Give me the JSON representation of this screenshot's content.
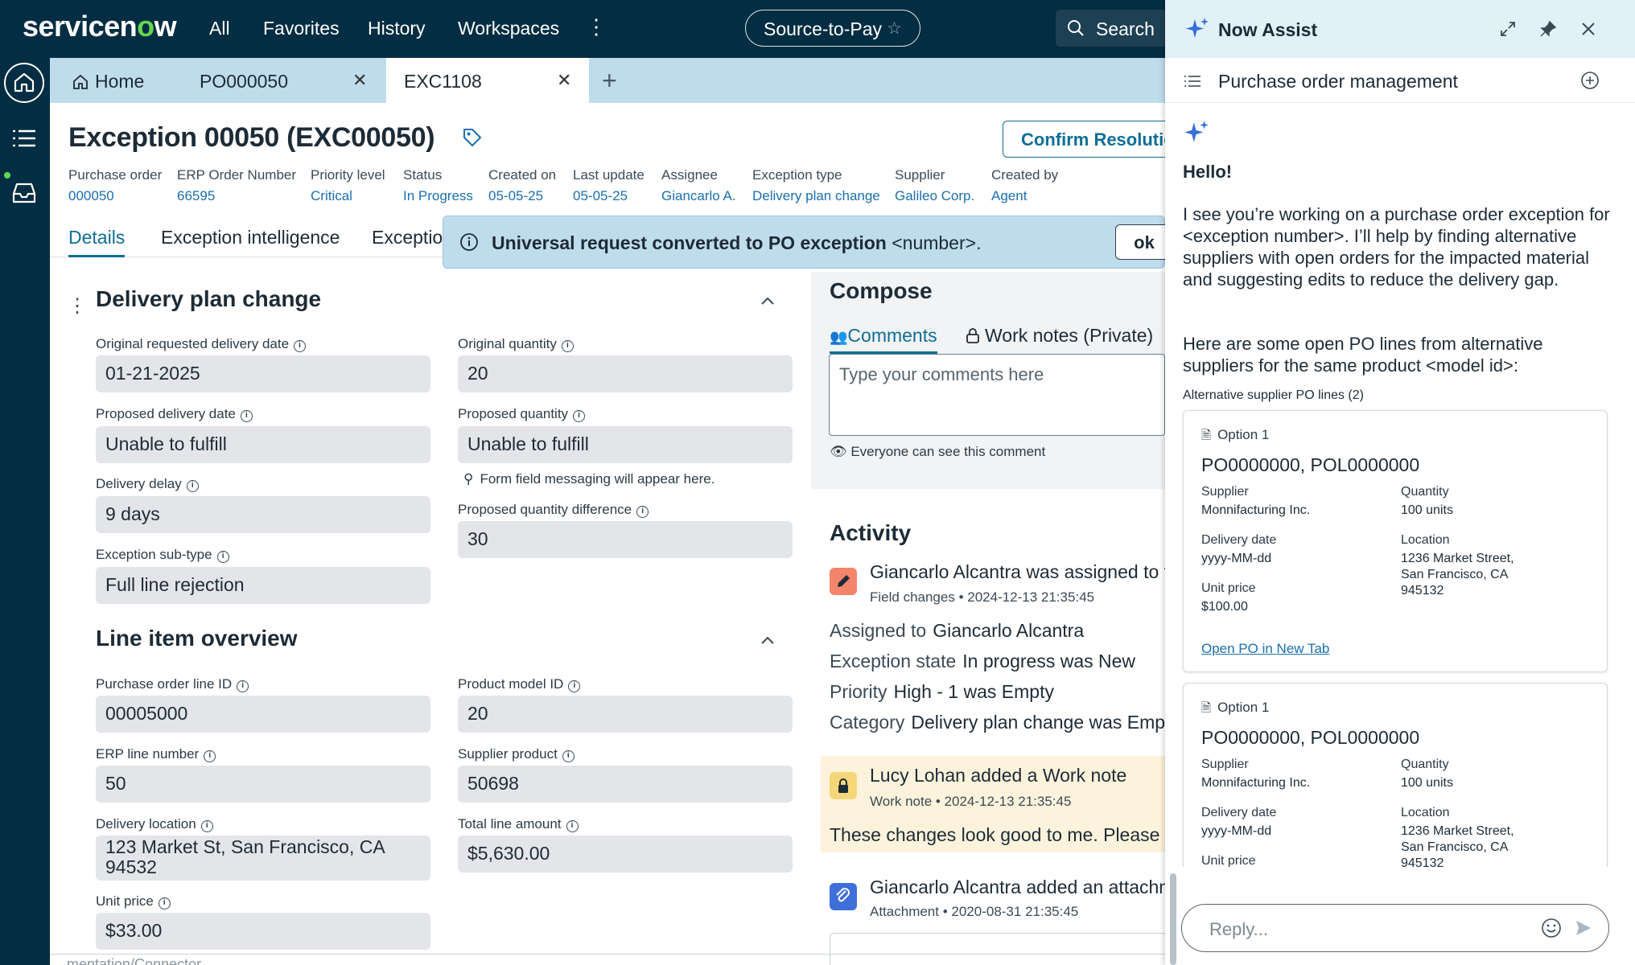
{
  "topnav": {
    "logo_text_before": "servicen",
    "logo_text_o": "o",
    "logo_text_after": "w",
    "items": [
      "All",
      "Favorites",
      "History",
      "Workspaces"
    ],
    "workspace": "Source-to-Pay",
    "search_label": "Search"
  },
  "tabs": {
    "home": "Home",
    "tab1": "PO000050",
    "tab2": "EXC1108"
  },
  "record": {
    "title": "Exception 00050 (EXC00050)",
    "confirm_button": "Confirm Resolution",
    "meta": [
      {
        "label": "Purchase order",
        "value": "000050"
      },
      {
        "label": "ERP Order Number",
        "value": "66595"
      },
      {
        "label": "Priority level",
        "value": "Critical"
      },
      {
        "label": "Status",
        "value": "In Progress"
      },
      {
        "label": "Created on",
        "value": "05-05-25"
      },
      {
        "label": "Last update",
        "value": "05-05-25"
      },
      {
        "label": "Assignee",
        "value": "Giancarlo A."
      },
      {
        "label": "Exception type",
        "value": "Delivery plan change"
      },
      {
        "label": "Supplier",
        "value": "Galileo Corp."
      },
      {
        "label": "Created by",
        "value": "Agent"
      }
    ],
    "subtabs": [
      "Details",
      "Exception intelligence",
      "Exception"
    ]
  },
  "banner": {
    "bold": "Universal request converted to PO exception",
    "rest": " <number>.",
    "ok": "ok"
  },
  "delivery_section": {
    "title": "Delivery plan change",
    "original_date_label": "Original requested delivery date",
    "original_date_value": "01-21-2025",
    "original_qty_label": "Original quantity",
    "original_qty_value": "20",
    "proposed_date_label": "Proposed delivery date",
    "proposed_date_value": "Unable to fulfill",
    "proposed_qty_label": "Proposed quantity",
    "proposed_qty_value": "Unable to fulfill",
    "form_msg": "Form field messaging will appear here.",
    "delay_label": "Delivery delay",
    "delay_value": "9 days",
    "qty_diff_label": "Proposed quantity difference",
    "qty_diff_value": "30",
    "subtype_label": "Exception sub-type",
    "subtype_value": "Full line rejection"
  },
  "line_section": {
    "title": "Line item overview",
    "po_line_label": "Purchase order line ID",
    "po_line_value": "00005000",
    "product_model_label": "Product model ID",
    "product_model_value": "20",
    "erp_line_label": "ERP line number",
    "erp_line_value": "50",
    "supplier_product_label": "Supplier product",
    "supplier_product_value": "50698",
    "delivery_loc_label": "Delivery location",
    "delivery_loc_value": "123 Market St, San Francisco, CA 94532",
    "total_label": "Total line amount",
    "total_value": "$5,630.00",
    "unit_price_label": "Unit price",
    "unit_price_value": "$33.00"
  },
  "compose": {
    "title": "Compose",
    "tab_comments": "Comments",
    "tab_worknotes": "Work notes (Private)",
    "placeholder": "Type your comments here",
    "hint": "Everyone can see this comment"
  },
  "activity": {
    "title": "Activity",
    "entry1_head": "Giancarlo Alcantra was assigned to th",
    "entry1_sub": "Field changes  •  2024-12-13 21:35:45",
    "rows": [
      {
        "k": "Assigned to",
        "v": "Giancarlo Alcantra"
      },
      {
        "k": "Exception state",
        "v": "In progress was New"
      },
      {
        "k": "Priority",
        "v": "High - 1 was Empty"
      },
      {
        "k": "Category",
        "v": "Delivery plan change was Empty"
      }
    ],
    "entry2_head": "Lucy Lohan added a Work note",
    "entry2_sub": "Work note  •  2024-12-13 21:35:45",
    "entry2_body": "These changes look good to me. Please up",
    "entry3_head": "Giancarlo Alcantra added an attachm",
    "entry3_sub": "Attachment  •  2020-08-31 21:35:45"
  },
  "footer_partial": "...mentation/Connector",
  "assist": {
    "title": "Now Assist",
    "conversation": "Purchase order management",
    "hello": "Hello!",
    "para1": "I see you’re working on a purchase order exception for <exception number>. I’ll help by finding alternative suppliers with open orders for the impacted material and suggesting edits to reduce the delivery gap.",
    "para2": "Here are some open PO lines from alternative suppliers for the same product <model id>:",
    "list_label": "Alternative supplier PO lines (2)",
    "cards": [
      {
        "option": "Option 1",
        "po": "PO0000000, POL0000000",
        "supplier_label": "Supplier",
        "supplier": "Monnifacturing Inc.",
        "qty_label": "Quantity",
        "qty": "100 units",
        "date_label": "Delivery date",
        "date": "yyyy-MM-dd",
        "loc_label": "Location",
        "loc_line1": "1236 Market Street,",
        "loc_line2": "San Francisco, CA",
        "loc_line3": "945132",
        "price_label": "Unit price",
        "price": "$100.00",
        "link": "Open PO in New Tab"
      },
      {
        "option": "Option 1",
        "po": "PO0000000, POL0000000",
        "supplier_label": "Supplier",
        "supplier": "Monnifacturing Inc.",
        "qty_label": "Quantity",
        "qty": "100 units",
        "date_label": "Delivery date",
        "date": "yyyy-MM-dd",
        "loc_label": "Location",
        "loc_line1": "1236 Market Street,",
        "loc_line2": "San Francisco, CA",
        "loc_line3": "945132",
        "price_label": "Unit price"
      }
    ],
    "reply_placeholder": "Reply..."
  },
  "colors": {
    "nav_bg": "#032d42",
    "accent": "#0e6e95",
    "link": "#1b6fae",
    "brand_green": "#62d84e",
    "tab_bar": "#bfdcec",
    "field_bg": "#e3e5e8"
  }
}
